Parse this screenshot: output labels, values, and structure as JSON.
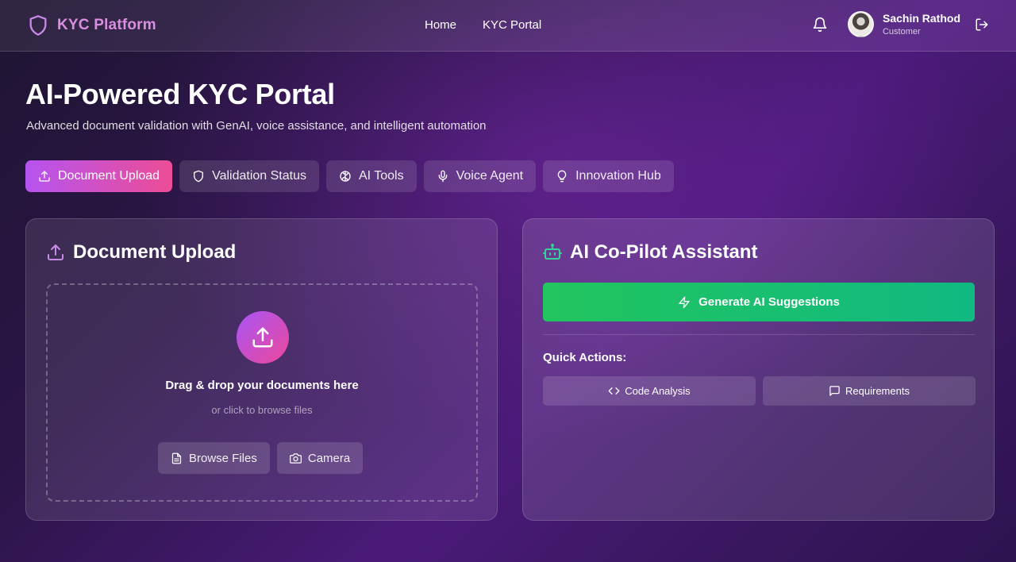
{
  "brand": {
    "name": "KYC Platform",
    "icon": "shield-icon"
  },
  "nav": [
    {
      "label": "Home"
    },
    {
      "label": "KYC Portal"
    }
  ],
  "user": {
    "name": "Sachin Rathod",
    "role": "Customer"
  },
  "hero": {
    "title": "AI-Powered KYC Portal",
    "subtitle": "Advanced document validation with GenAI, voice assistance, and intelligent automation"
  },
  "tabs": [
    {
      "label": "Document Upload",
      "icon": "upload-icon",
      "active": true
    },
    {
      "label": "Validation Status",
      "icon": "shield-icon"
    },
    {
      "label": "AI Tools",
      "icon": "brain-icon"
    },
    {
      "label": "Voice Agent",
      "icon": "mic-icon"
    },
    {
      "label": "Innovation Hub",
      "icon": "lightbulb-icon"
    }
  ],
  "upload": {
    "title": "Document Upload",
    "drop_title": "Drag & drop your documents here",
    "drop_sub": "or click to browse files",
    "browse_label": "Browse Files",
    "camera_label": "Camera"
  },
  "copilot": {
    "title": "AI Co-Pilot Assistant",
    "generate_label": "Generate AI Suggestions",
    "quick_actions_label": "Quick Actions:",
    "actions": [
      {
        "label": "Code Analysis",
        "icon": "code-icon"
      },
      {
        "label": "Requirements",
        "icon": "message-icon"
      }
    ]
  },
  "colors": {
    "brand_text": "#d98ee0",
    "tab_active_from": "#b654f0",
    "tab_active_to": "#ec4d95",
    "generate_from": "#22c55e",
    "generate_to": "#10b981",
    "copilot_icon": "#34d399"
  }
}
